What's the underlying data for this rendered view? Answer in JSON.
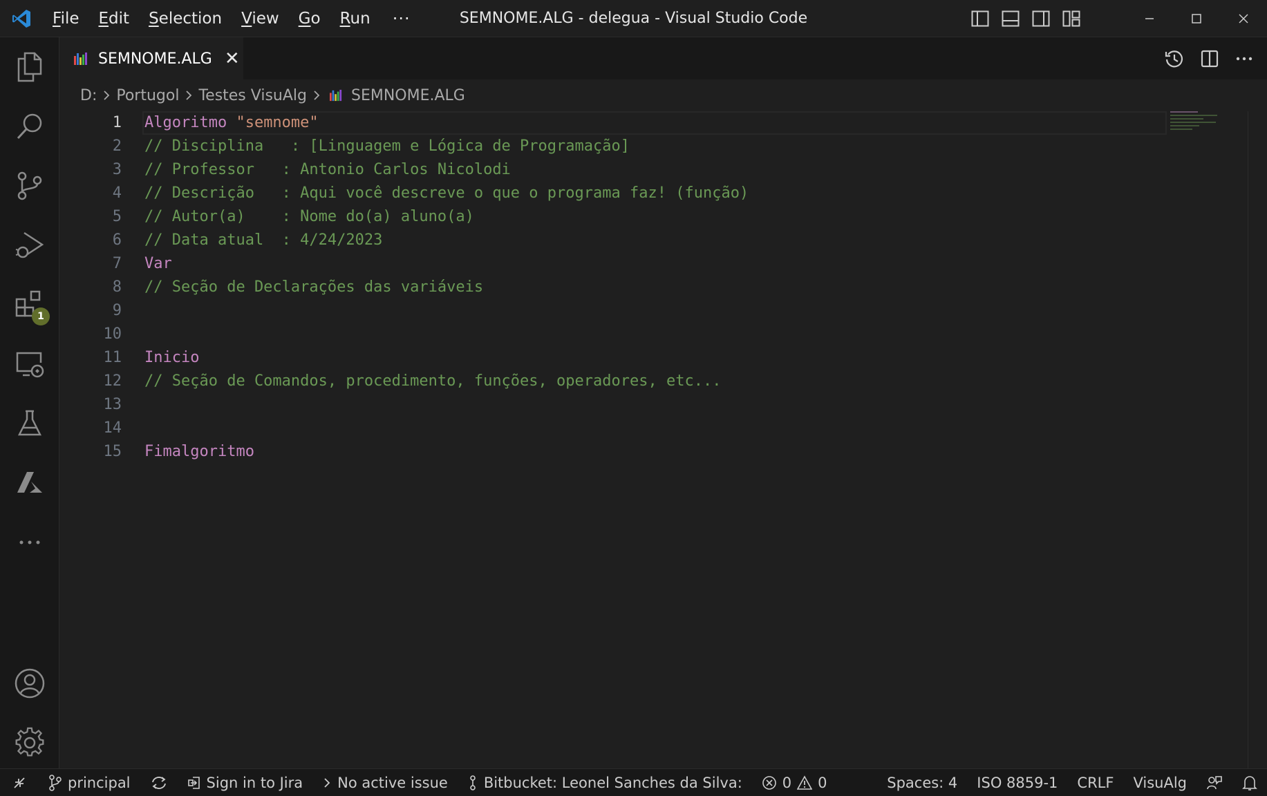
{
  "window": {
    "title": "SEMNOME.ALG - delegua - Visual Studio Code"
  },
  "menu": {
    "items": [
      {
        "prefix": "",
        "mnemonic": "F",
        "rest": "ile"
      },
      {
        "prefix": "",
        "mnemonic": "E",
        "rest": "dit"
      },
      {
        "prefix": "",
        "mnemonic": "S",
        "rest": "election"
      },
      {
        "prefix": "",
        "mnemonic": "V",
        "rest": "iew"
      },
      {
        "prefix": "",
        "mnemonic": "G",
        "rest": "o"
      },
      {
        "prefix": "",
        "mnemonic": "R",
        "rest": "un"
      }
    ],
    "more": "···"
  },
  "activity": {
    "extensions_badge": "1"
  },
  "tab": {
    "label": "SEMNOME.ALG",
    "close": "✕"
  },
  "breadcrumbs": [
    "D:",
    "Portugol",
    "Testes VisuAlg",
    "SEMNOME.ALG"
  ],
  "editor": {
    "active_line": 1,
    "line_numbers": [
      "1",
      "2",
      "3",
      "4",
      "5",
      "6",
      "7",
      "8",
      "9",
      "10",
      "11",
      "12",
      "13",
      "14",
      "15"
    ],
    "lines": {
      "l1_kw": "Algoritmo ",
      "l1_str": "\"semnome\"",
      "l2": "// Disciplina   : [Linguagem e Lógica de Programação]",
      "l3": "// Professor   : Antonio Carlos Nicolodi",
      "l4": "// Descrição   : Aqui você descreve o que o programa faz! (função)",
      "l5": "// Autor(a)    : Nome do(a) aluno(a)",
      "l6": "// Data atual  : 4/24/2023",
      "l7": "Var",
      "l8": "// Seção de Declarações das variáveis",
      "l11": "Inicio",
      "l12": "// Seção de Comandos, procedimento, funções, operadores, etc...",
      "l15": "Fimalgoritmo"
    }
  },
  "statusbar": {
    "branch": "principal",
    "jira": "Sign in to Jira",
    "issue": "No active issue",
    "bitbucket": "Bitbucket: Leonel Sanches da Silva:",
    "errors": "0",
    "warnings": "0",
    "spaces": "Spaces: 4",
    "encoding": "ISO 8859-1",
    "eol": "CRLF",
    "language": "VisuAlg"
  },
  "colors": {
    "accent": "#0078d4",
    "keyword": "#c586c0",
    "string": "#ce9178",
    "comment": "#6a9955",
    "badge": "#616e2b"
  }
}
